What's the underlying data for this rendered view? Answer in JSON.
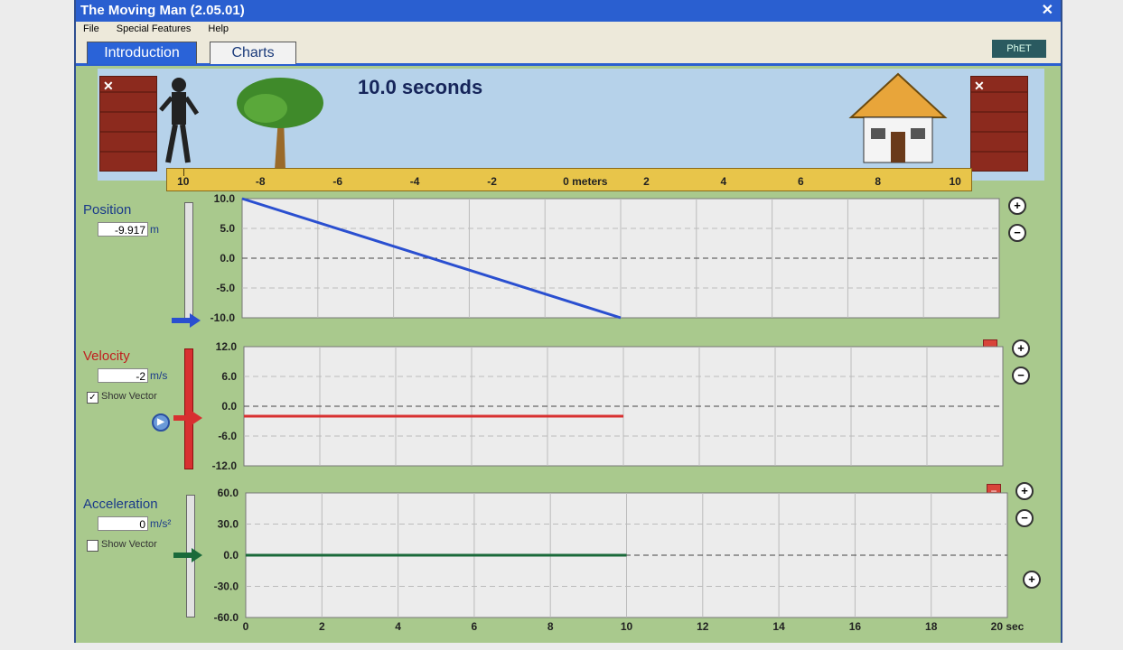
{
  "app": {
    "title": "The Moving Man (2.05.01)",
    "close_glyph": "✕"
  },
  "menu": [
    "File",
    "Special Features",
    "Help"
  ],
  "tabs": [
    {
      "label": "Introduction"
    },
    {
      "label": "Charts"
    }
  ],
  "logo_text": "PhET",
  "scene": {
    "time_label": "10.0 seconds",
    "wall_close": "✕",
    "ruler_labels": [
      "10",
      "-8",
      "-6",
      "-4",
      "-2",
      "0 meters",
      "2",
      "4",
      "6",
      "8",
      "10"
    ]
  },
  "position": {
    "label": "Position",
    "value": "-9.917",
    "unit": "m",
    "color": "#2a4fd0"
  },
  "velocity": {
    "label": "Velocity",
    "value": "-2",
    "unit": "m/s",
    "show_vector_label": "Show Vector",
    "show_vector_checked": true,
    "check_glyph": "✓",
    "color": "#d83030"
  },
  "acceleration": {
    "label": "Acceleration",
    "value": "0",
    "unit": "m/s²",
    "show_vector_label": "Show Vector",
    "show_vector_checked": false,
    "color": "#1a6a3a"
  },
  "x_axis": {
    "ticks": [
      "0",
      "2",
      "4",
      "6",
      "8",
      "10",
      "12",
      "14",
      "16",
      "18",
      "20 sec"
    ]
  },
  "chart_data": [
    {
      "type": "line",
      "series": [
        {
          "x": [
            0,
            10
          ],
          "y": [
            10.0,
            -10.0
          ]
        }
      ],
      "ylim": [
        -10.0,
        10.0
      ],
      "xlim": [
        0,
        20
      ],
      "ytick_labels": [
        "10.0",
        "5.0",
        "0.0",
        "-5.0",
        "-10.0"
      ]
    },
    {
      "type": "line",
      "series": [
        {
          "x": [
            0,
            10
          ],
          "y": [
            -2,
            -2
          ]
        }
      ],
      "ylim": [
        -12.0,
        12.0
      ],
      "xlim": [
        0,
        20
      ],
      "ytick_labels": [
        "12.0",
        "6.0",
        "0.0",
        "-6.0",
        "-12.0"
      ]
    },
    {
      "type": "line",
      "series": [
        {
          "x": [
            0,
            10
          ],
          "y": [
            0,
            0
          ]
        }
      ],
      "ylim": [
        -60.0,
        60.0
      ],
      "xlim": [
        0,
        20
      ],
      "ytick_labels": [
        "60.0",
        "30.0",
        "0.0",
        "-30.0",
        "-60.0"
      ]
    }
  ]
}
